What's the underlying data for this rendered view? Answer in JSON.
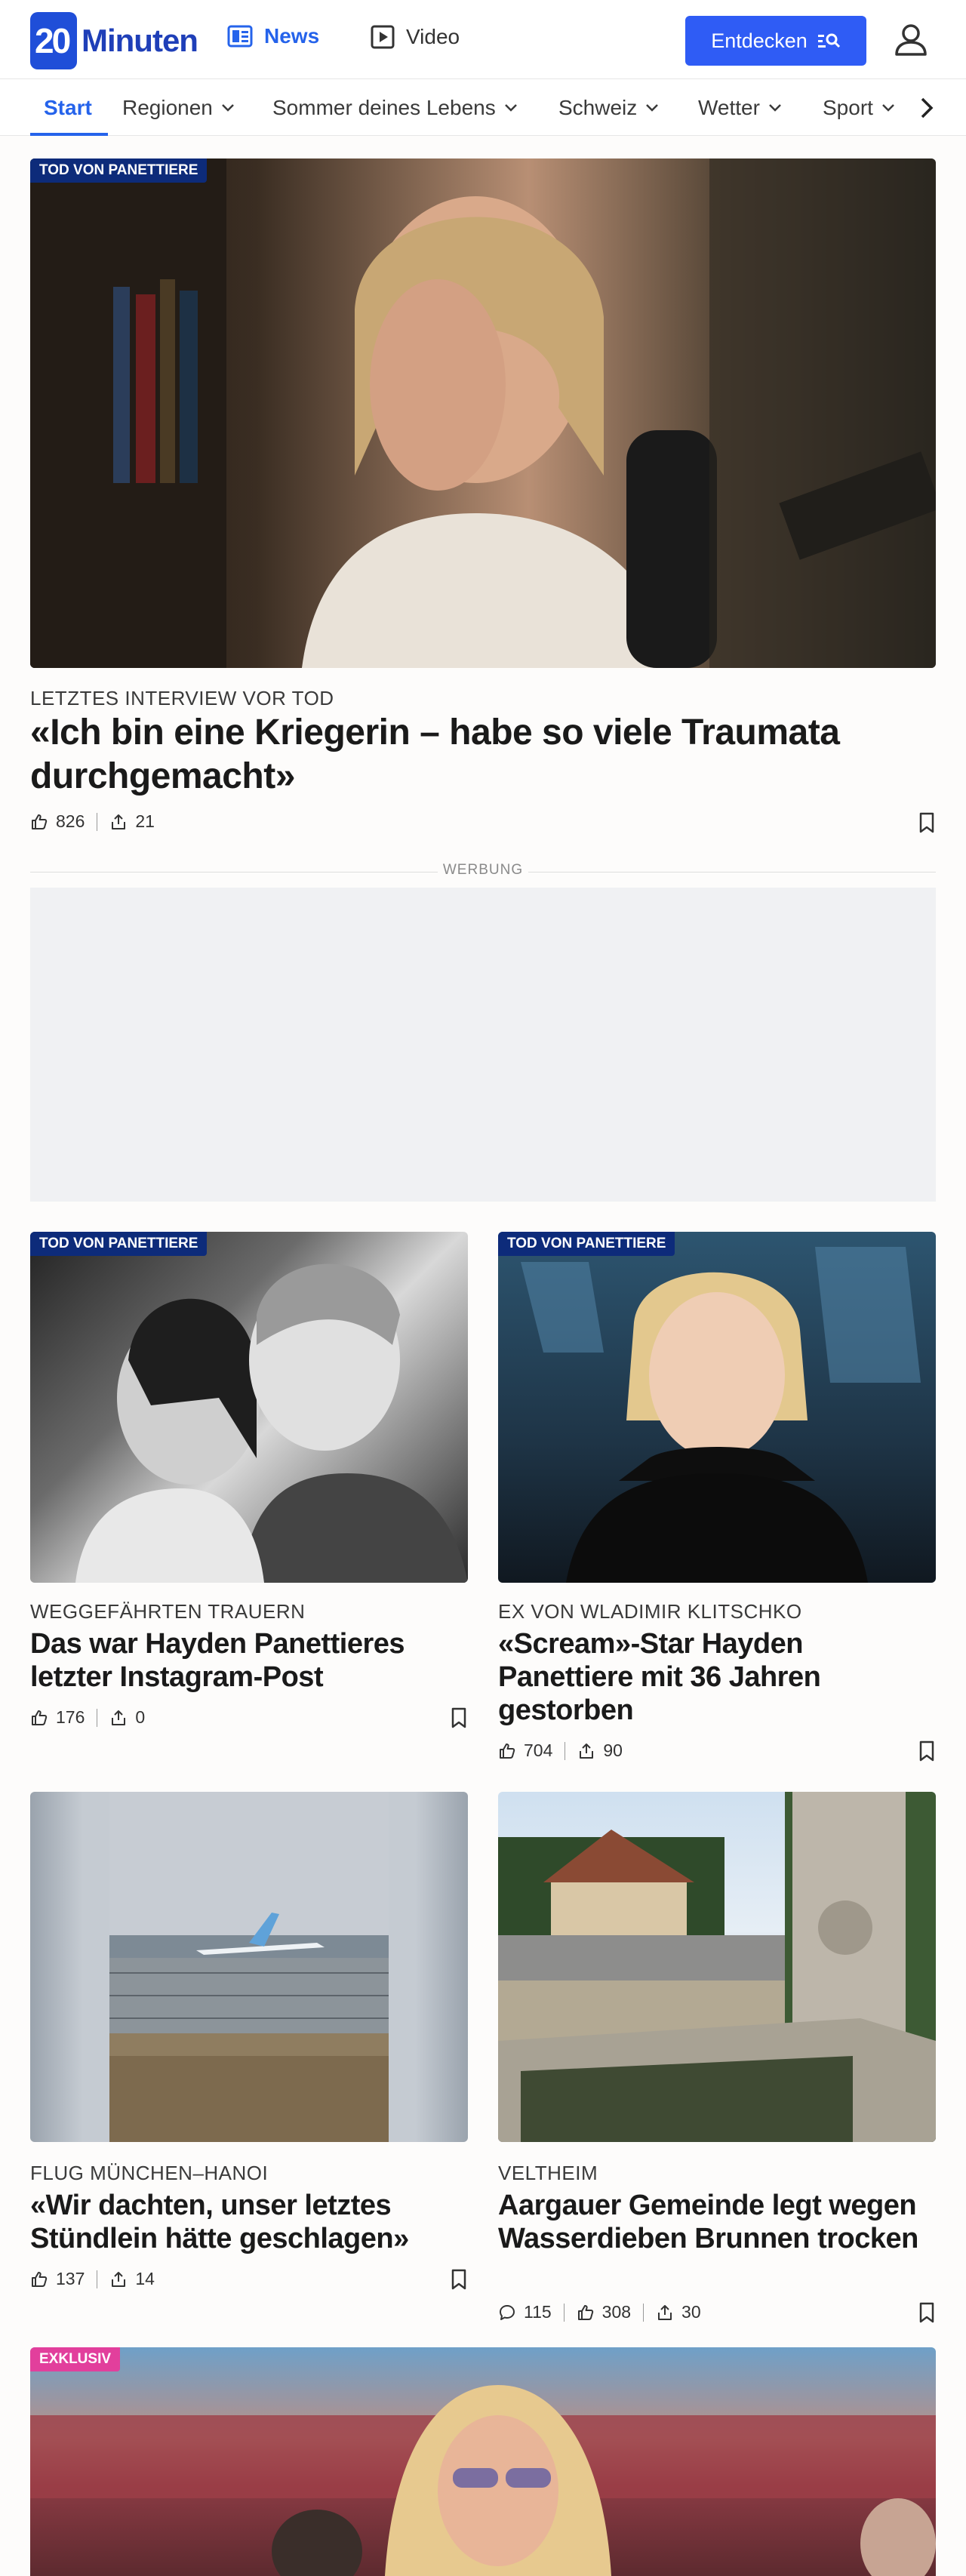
{
  "header": {
    "logo_number": "20",
    "logo_text": "Minuten",
    "nav_news": "News",
    "nav_video": "Video",
    "discover_button": "Entdecken",
    "colors": {
      "brand": "#1f4ed8",
      "accent": "#2f5cf5"
    }
  },
  "subnav": {
    "items": [
      {
        "label": "Start",
        "active": true
      },
      {
        "label": "Regionen"
      },
      {
        "label": "Sommer deines Lebens"
      },
      {
        "label": "Schweiz"
      },
      {
        "label": "Wetter"
      },
      {
        "label": "Sport"
      }
    ]
  },
  "hero": {
    "badge": "TOD VON PANETTIERE",
    "kicker": "LETZTES INTERVIEW VOR TOD",
    "headline": "«Ich bin eine Kriegerin – habe so viele Traumata durchgemacht»",
    "likes": "826",
    "shares": "21"
  },
  "ad": {
    "label": "WERBUNG"
  },
  "articles": [
    {
      "badge": "TOD VON PANETTIERE",
      "kicker": "WEGGEFÄHRTEN TRAUERN",
      "headline": "Das war Hayden Panettieres letzter Instagram-Post",
      "likes": "176",
      "shares": "0"
    },
    {
      "badge": "TOD VON PANETTIERE",
      "kicker": "EX VON WLADIMIR KLITSCHKO",
      "headline": "«Scream»-Star Hayden Panettiere mit 36 Jahren gestorben",
      "likes": "704",
      "shares": "90"
    },
    {
      "kicker": "FLUG MÜNCHEN–HANOI",
      "headline": "«Wir dachten, unser letztes Stündlein hätte geschlagen»",
      "likes": "137",
      "shares": "14"
    },
    {
      "kicker": "VELTHEIM",
      "headline": "Aargauer Gemeinde legt wegen Wasserdieben Brunnen trocken",
      "comments": "115",
      "likes": "308",
      "shares": "30"
    },
    {
      "badge": "EXKLUSIV"
    }
  ]
}
